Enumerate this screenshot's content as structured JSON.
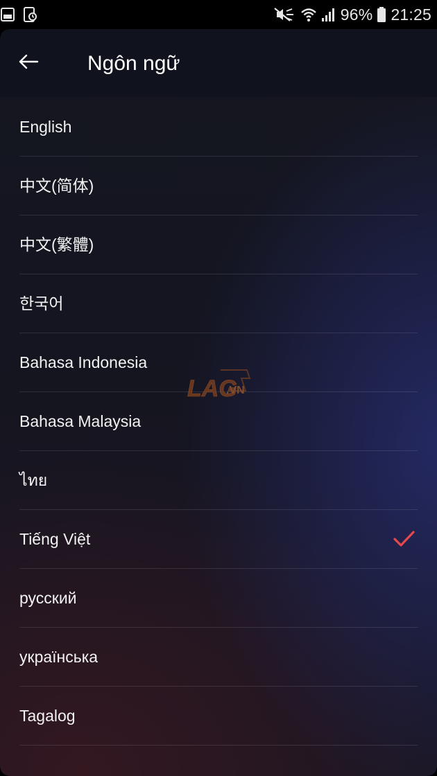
{
  "status_bar": {
    "battery_percent": "96%",
    "time": "21:25"
  },
  "header": {
    "title": "Ngôn ngữ",
    "back_icon": "arrow-left-icon"
  },
  "languages": [
    {
      "label": "English",
      "selected": false
    },
    {
      "label": "中文(简体)",
      "selected": false
    },
    {
      "label": "中文(繁體)",
      "selected": false
    },
    {
      "label": "한국어",
      "selected": false
    },
    {
      "label": "Bahasa Indonesia",
      "selected": false
    },
    {
      "label": "Bahasa Malaysia",
      "selected": false
    },
    {
      "label": "ไทย",
      "selected": false
    },
    {
      "label": "Tiếng Việt",
      "selected": true
    },
    {
      "label": "русский",
      "selected": false
    },
    {
      "label": "українська",
      "selected": false
    },
    {
      "label": "Tagalog",
      "selected": false
    }
  ],
  "colors": {
    "accent_check": "#e5484d",
    "background": "#15161f"
  },
  "watermark": {
    "brand": "LAG",
    "suffix": ".VN"
  }
}
